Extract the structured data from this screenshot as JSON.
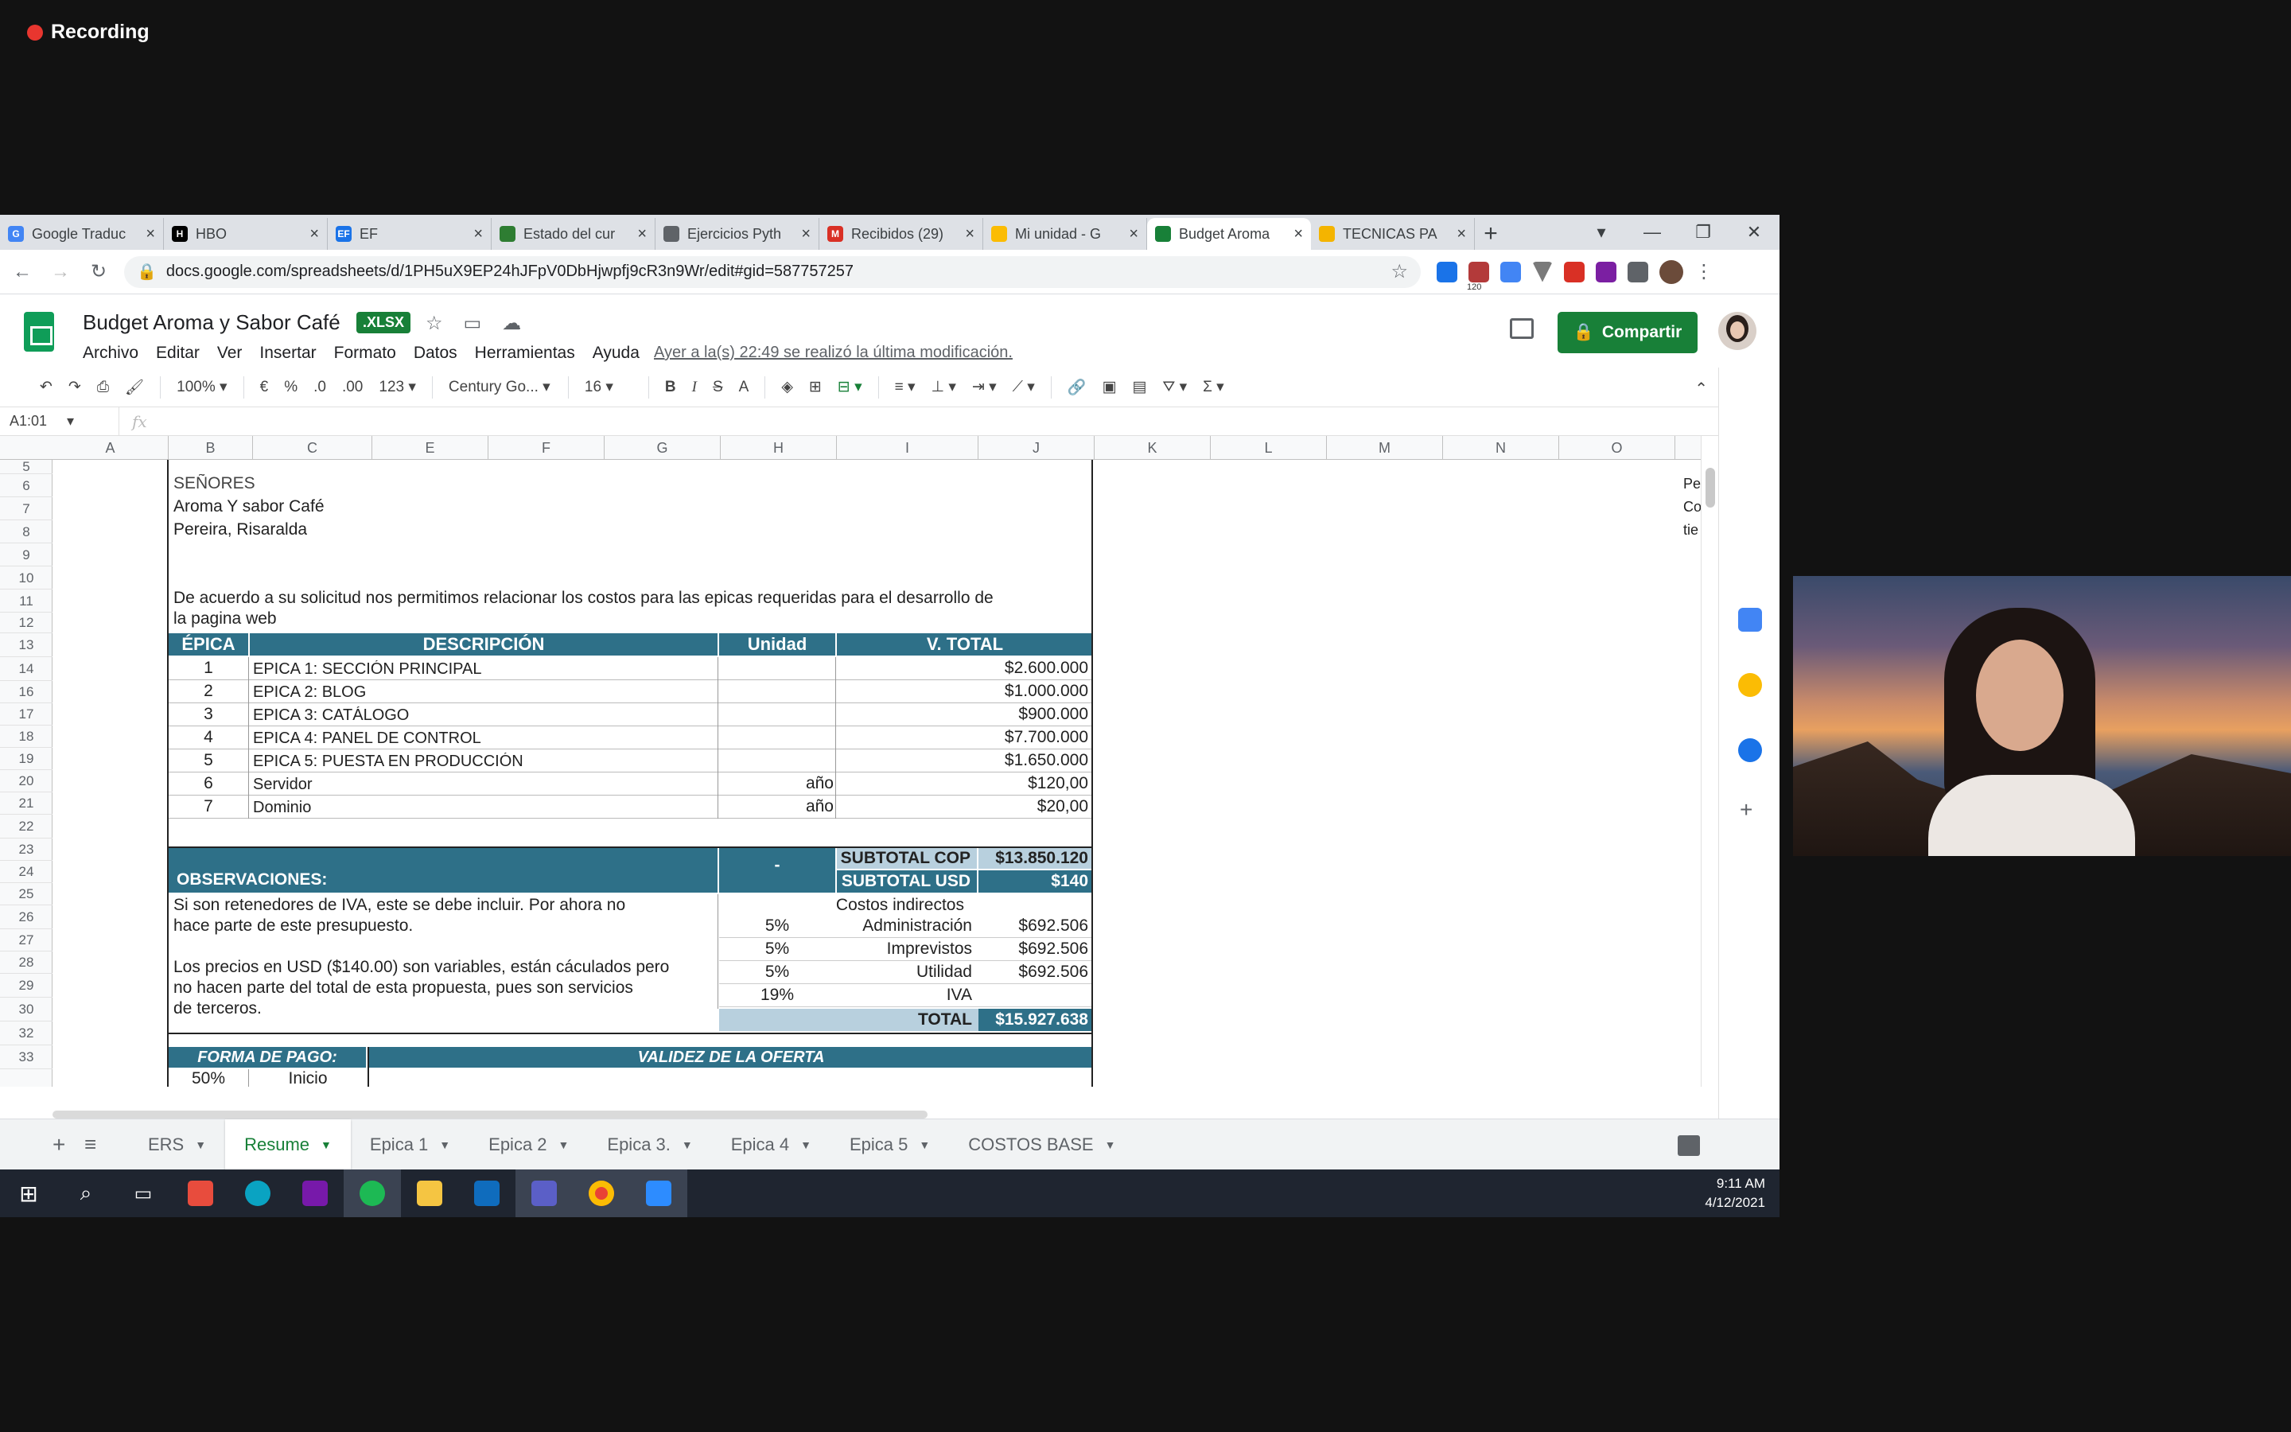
{
  "recording": {
    "label": "Recording"
  },
  "browser": {
    "tabs": [
      {
        "label": "Google Traduc",
        "fav_color": "#4285f4",
        "fav": "G"
      },
      {
        "label": "HBO",
        "fav_color": "#000000",
        "fav": "H"
      },
      {
        "label": "EF",
        "fav_color": "#1a73e8",
        "fav": "EF"
      },
      {
        "label": "Estado del cur",
        "fav_color": "#2e7d32",
        "fav": ""
      },
      {
        "label": "Ejercicios Pyth",
        "fav_color": "#5f6368",
        "fav": ""
      },
      {
        "label": "Recibidos (29)",
        "fav_color": "#d93025",
        "fav": "M"
      },
      {
        "label": "Mi unidad - G",
        "fav_color": "#fbbc04",
        "fav": ""
      },
      {
        "label": "Budget Aroma",
        "fav_color": "#188038",
        "fav": ""
      },
      {
        "label": "TECNICAS PA",
        "fav_color": "#f4b400",
        "fav": ""
      }
    ],
    "url": "docs.google.com/spreadsheets/d/1PH5uX9EP24hJFpV0DbHjwpfj9cR3n9Wr/edit#gid=587757257",
    "ext_badge": "120"
  },
  "sheets": {
    "title": "Budget Aroma y Sabor Café",
    "badge": ".XLSX",
    "menu": [
      "Archivo",
      "Editar",
      "Ver",
      "Insertar",
      "Formato",
      "Datos",
      "Herramientas",
      "Ayuda"
    ],
    "last_edit": "Ayer a la(s) 22:49 se realizó la última modificación.",
    "share": "Compartir",
    "toolbar": {
      "zoom": "100%",
      "currency": "€",
      "percent": "%",
      "dec_less": ".0",
      "dec_more": ".00",
      "format": "123",
      "font": "Century Go...",
      "size": "16"
    },
    "namebox": "A1:01",
    "fx": "fx"
  },
  "columns": [
    "A",
    "B",
    "C",
    "E",
    "F",
    "G",
    "H",
    "I",
    "J",
    "K",
    "L",
    "M",
    "N",
    "O"
  ],
  "rows": [
    "5",
    "6",
    "7",
    "8",
    "9",
    "10",
    "11",
    "12",
    "13",
    "14",
    "16",
    "17",
    "18",
    "19",
    "20",
    "21",
    "22",
    "23",
    "24",
    "25",
    "26",
    "27",
    "28",
    "29",
    "30",
    "32",
    "33"
  ],
  "doc": {
    "senores": "SEÑORES",
    "client": "Aroma Y sabor Café",
    "city": "Pereira, Risaralda",
    "intro1": "De acuerdo a su solicitud nos permitimos relacionar los costos para las epicas requeridas para el desarrollo de",
    "intro2": "la pagina web",
    "headers": {
      "epica": "ÉPICA",
      "descripcion": "DESCRIPCIÓN",
      "unidad": "Unidad",
      "vtotal": "V. TOTAL"
    },
    "items": [
      {
        "n": "1",
        "desc": "EPICA 1: SECCIÓN PRINCIPAL",
        "unit": "",
        "total": "$2.600.000"
      },
      {
        "n": "2",
        "desc": "EPICA 2:  BLOG",
        "unit": "",
        "total": "$1.000.000"
      },
      {
        "n": "3",
        "desc": "EPICA 3:  CATÁLOGO",
        "unit": "",
        "total": "$900.000"
      },
      {
        "n": "4",
        "desc": "EPICA 4: PANEL DE CONTROL",
        "unit": "",
        "total": "$7.700.000"
      },
      {
        "n": "5",
        "desc": "EPICA 5: PUESTA EN PRODUCCIÓN",
        "unit": "",
        "total": "$1.650.000"
      },
      {
        "n": "6",
        "desc": "Servidor",
        "unit": "año",
        "total": "$120,00"
      },
      {
        "n": "7",
        "desc": "Dominio",
        "unit": "año",
        "total": "$20,00"
      }
    ],
    "dash": "-",
    "subtotal_cop_label": "SUBTOTAL COP",
    "subtotal_cop": "$13.850.120",
    "observaciones": "OBSERVACIONES:",
    "subtotal_usd_label": "SUBTOTAL USD",
    "subtotal_usd": "$140",
    "obs1a": "Si son retenedores de IVA, este se debe incluir. Por ahora no",
    "obs1b": "hace parte de este presupuesto.",
    "obs2a": "Los precios en USD ($140.00) son variables, están cáculados pero",
    "obs2b": "no hacen parte del total de esta propuesta, pues son servicios",
    "obs2c": "de terceros.",
    "costos_indirectos": "Costos indirectos",
    "indirect": [
      {
        "pct": "5%",
        "label": "Administración",
        "value": "$692.506"
      },
      {
        "pct": "5%",
        "label": "Imprevistos",
        "value": "$692.506"
      },
      {
        "pct": "5%",
        "label": "Utilidad",
        "value": "$692.506"
      },
      {
        "pct": "19%",
        "label": "IVA",
        "value": ""
      }
    ],
    "total_label": "TOTAL",
    "total": "$15.927.638",
    "forma_pago": "FORMA DE PAGO:",
    "validez": "VALIDEZ DE LA OFERTA",
    "pago_pct": "50%",
    "pago_inicio": "Inicio",
    "side_text": [
      "Pe",
      "Co",
      "tie"
    ]
  },
  "sheet_tabs": [
    "ERS",
    "Resume",
    "Epica 1",
    "Epica 2",
    "Epica 3.",
    "Epica 4",
    "Epica 5",
    "COSTOS BASE"
  ],
  "active_sheet": "Resume",
  "taskbar": {
    "time": "9:11 AM",
    "date": "4/12/2021"
  }
}
